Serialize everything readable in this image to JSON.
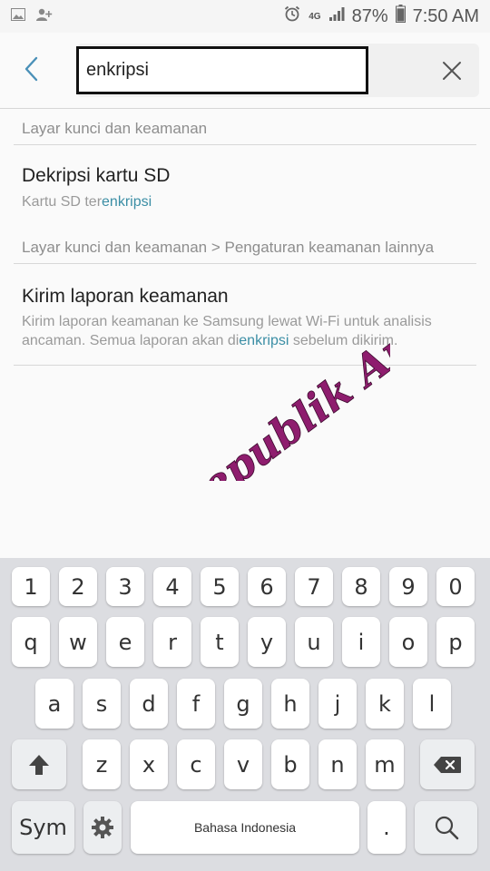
{
  "status_bar": {
    "network": "4G",
    "battery": "87%",
    "time": "7:50 AM"
  },
  "search": {
    "query": "enkripsi"
  },
  "results": [
    {
      "section": "Layar kunci dan keamanan",
      "title": "Dekripsi kartu SD",
      "summary_before": "Kartu SD ter",
      "summary_highlight": "enkripsi",
      "summary_after": ""
    },
    {
      "section": "Layar kunci dan keamanan > Pengaturan keamanan lainnya",
      "title": "Kirim laporan keamanan",
      "summary_before": "Kirim laporan keamanan ke Samsung lewat Wi-Fi untuk analisis ancaman. Semua laporan akan di",
      "summary_highlight": "enkripsi",
      "summary_after": " sebelum dikirim."
    }
  ],
  "watermark": "Republik Android",
  "keyboard": {
    "number_row": [
      "1",
      "2",
      "3",
      "4",
      "5",
      "6",
      "7",
      "8",
      "9",
      "0"
    ],
    "row1": [
      "q",
      "w",
      "e",
      "r",
      "t",
      "y",
      "u",
      "i",
      "o",
      "p"
    ],
    "row2": [
      "a",
      "s",
      "d",
      "f",
      "g",
      "h",
      "j",
      "k",
      "l"
    ],
    "row3": [
      "z",
      "x",
      "c",
      "v",
      "b",
      "n",
      "m"
    ],
    "sym_label": "Sym",
    "space_label": "Bahasa Indonesia",
    "period_label": "."
  },
  "colors": {
    "highlight": "#3b8ea5",
    "back_arrow": "#4a90b8",
    "watermark": "#8e1d6e"
  }
}
